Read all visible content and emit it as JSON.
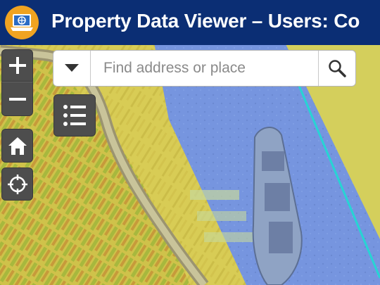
{
  "header": {
    "title": "Property Data Viewer – Users: Co",
    "logo_icon": "laptop-globe-icon",
    "background": "#0b2e74",
    "logo_color": "#f0a321"
  },
  "map_tools": {
    "zoom_in_icon": "plus-icon",
    "zoom_out_icon": "minus-icon",
    "home_icon": "home-icon",
    "locate_icon": "crosshair-icon",
    "layers_icon": "list-icon"
  },
  "search": {
    "placeholder": "Find address or place",
    "value": "",
    "dropdown_icon": "chevron-down-icon",
    "search_icon": "search-icon"
  },
  "map": {
    "parcel_fill": "#ded04f",
    "water_overlay": "#7a98e6",
    "parcel_outline": "#27d4d4"
  }
}
